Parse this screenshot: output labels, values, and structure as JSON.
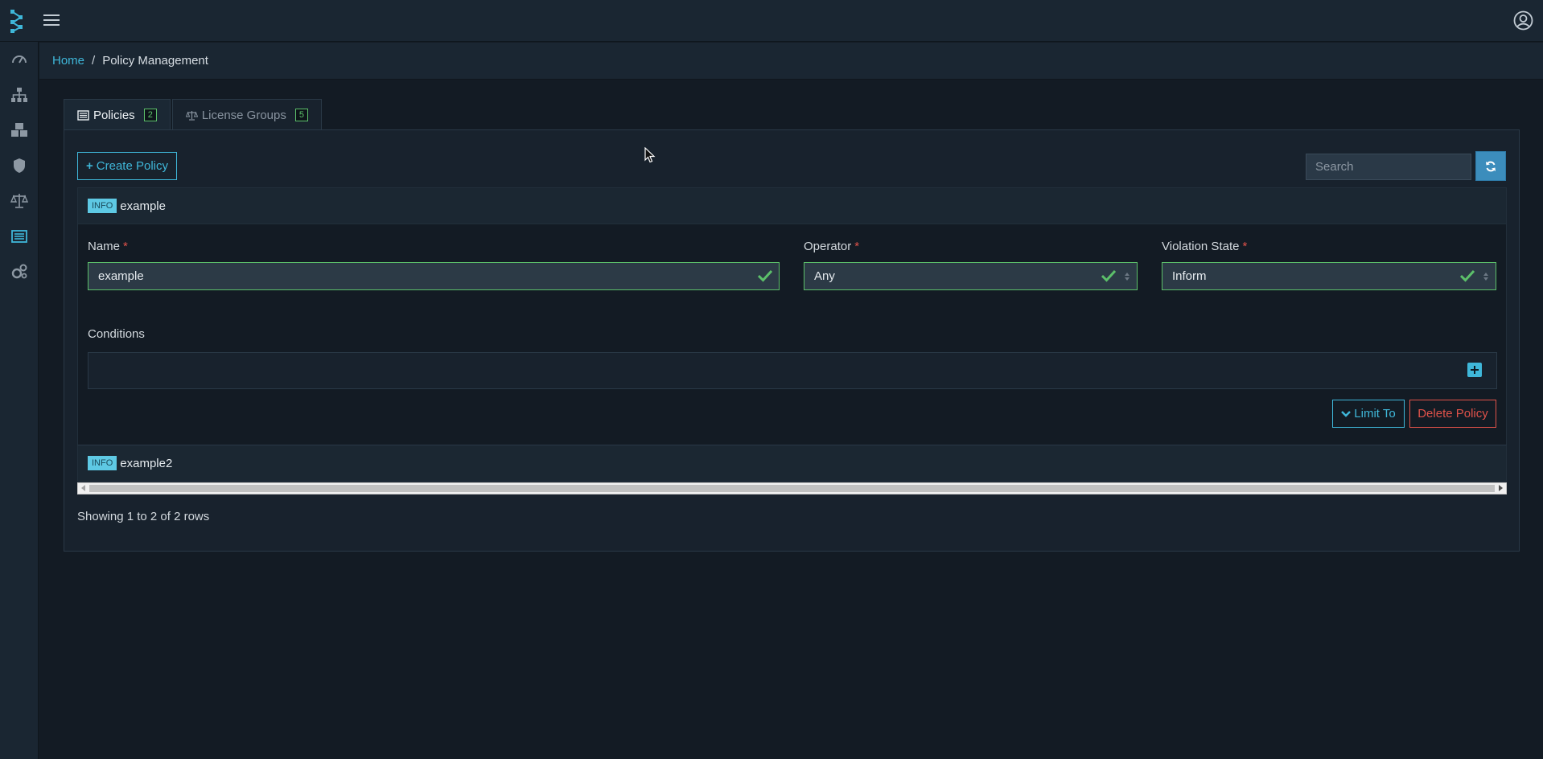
{
  "breadcrumb": {
    "home": "Home",
    "current": "Policy Management"
  },
  "tabs": [
    {
      "label": "Policies",
      "count": "2",
      "active": true,
      "icon": "list-alt-icon"
    },
    {
      "label": "License Groups",
      "count": "5",
      "active": false,
      "icon": "balance-scale-icon"
    }
  ],
  "toolbar": {
    "create_label": "Create Policy",
    "search_placeholder": "Search"
  },
  "policies": [
    {
      "tag": "INFO",
      "name": "example",
      "expanded": true,
      "fields": {
        "name_label": "Name",
        "name_value": "example",
        "operator_label": "Operator",
        "operator_value": "Any",
        "violation_label": "Violation State",
        "violation_value": "Inform"
      },
      "conditions_label": "Conditions",
      "limit_label": "Limit To",
      "delete_label": "Delete Policy"
    },
    {
      "tag": "INFO",
      "name": "example2",
      "expanded": false
    }
  ],
  "required_marker": "*",
  "pagination": "Showing 1 to 2 of 2 rows",
  "colors": {
    "accent": "#3fb7d9",
    "valid": "#5cc06a",
    "danger": "#e0524a",
    "background": "#131b24"
  }
}
